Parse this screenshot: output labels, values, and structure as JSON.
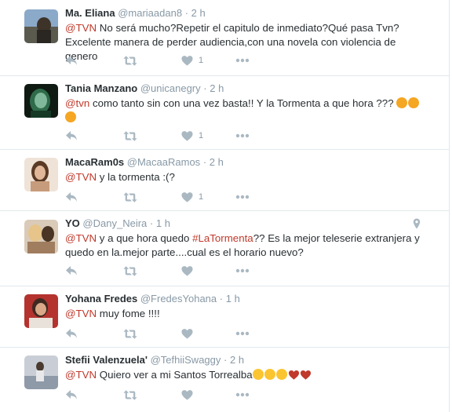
{
  "tweets": [
    {
      "name": "Ma. Eliana",
      "handle": "@mariaadan8",
      "sep": "·",
      "time": "2 h",
      "mention": "@TVN",
      "text": " No será mucho?Repetir el capitulo de inmediato?Qué pasa Tvn? Excelente manera de perder audiencia,con una novela con violencia de genero",
      "likes": "1"
    },
    {
      "name": "Tania Manzano",
      "handle": "@unicanegry",
      "sep": "·",
      "time": "2 h",
      "mention": "@tvn",
      "text": " como tanto sin con una vez basta!! Y la Tormenta a que hora ??? ",
      "likes": "1"
    },
    {
      "name": "MacaRam0s",
      "handle": "@MacaaRamos",
      "sep": "·",
      "time": "2 h",
      "mention": "@TVN",
      "text": " y la tormenta :(?",
      "likes": "1"
    },
    {
      "name": "YO",
      "handle": "@Dany_Neira",
      "sep": "·",
      "time": "1 h",
      "mention": "@TVN",
      "text_a": " y a que hora quedo ",
      "hashtag": "#LaTormenta",
      "text_b": "?? Es la mejor teleserie extranjera y quedo en la.mejor parte....cual es el horario nuevo?",
      "likes": ""
    },
    {
      "name": "Yohana Fredes",
      "handle": "@FredesYohana",
      "sep": "·",
      "time": "1 h",
      "mention": "@TVN",
      "text": " muy fome !!!!",
      "likes": ""
    },
    {
      "name": "Stefii Valenzuela'",
      "handle": "@TefhiiSwaggy",
      "sep": "·",
      "time": "2 h",
      "mention": "@TVN",
      "text": " Quiero ver a mi Santos Torrealba",
      "likes": ""
    }
  ],
  "icons": {
    "reply": "reply-icon",
    "retweet": "retweet-icon",
    "like": "heart-icon",
    "more": "more-icon",
    "location": "location-pin-icon"
  },
  "colors": {
    "link": "#c0392b",
    "meta": "#8899a6",
    "action": "#aab8c2",
    "divider": "#e1e8ed"
  }
}
